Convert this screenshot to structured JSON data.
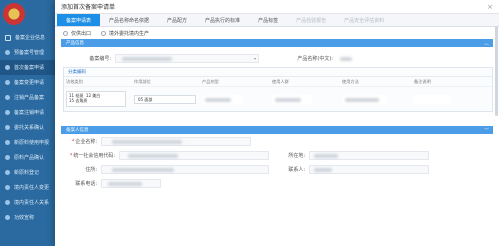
{
  "dialog": {
    "title": "添加首次备案申请单",
    "close": "×"
  },
  "tabs": [
    {
      "label": "备案申请表",
      "active": true,
      "muted": false
    },
    {
      "label": "产品名称命名依据",
      "active": false,
      "muted": false
    },
    {
      "label": "产品配方",
      "active": false,
      "muted": false
    },
    {
      "label": "产品执行的标准",
      "active": false,
      "muted": false
    },
    {
      "label": "产品标签",
      "active": false,
      "muted": false
    },
    {
      "label": "产品检验报告",
      "active": false,
      "muted": true
    },
    {
      "label": "产品安全评估资料",
      "active": false,
      "muted": true
    }
  ],
  "radios": [
    {
      "label": "仅供出口"
    },
    {
      "label": "境外委托境内生产"
    }
  ],
  "product_section": {
    "title": "产品信息",
    "chevron": "︿",
    "record_no_label": "备案编号:",
    "name_label": "产品名称(中文):",
    "subpanel_title": "分类编码",
    "columns": [
      "功效类别",
      "作用部位",
      "产品剂型",
      "使用人群",
      "使用方法",
      "备注说明"
    ],
    "efficacy_options": [
      "11 祛斑",
      "12 美白",
      "15 去角质"
    ],
    "site_value": "05 面部"
  },
  "applicant_section": {
    "title": "备案人信息",
    "chevron": "﹀",
    "company_label": "企业名称:",
    "credit_label": "统一社会信用代码:",
    "address_label": "住所:",
    "phone_label": "联系电话:",
    "province_label": "所在地:",
    "contact_label": "联系人:"
  },
  "app_sidebar": {
    "items": [
      "备案企业信息",
      "预备案号管理",
      "首次备案申请",
      "备案变更申请",
      "注销产品备案",
      "备案注销申请",
      "委托关系确认",
      "新原料使用申报",
      "原料产品确认",
      "新原料登记",
      "境内责任人变更",
      "境内责任人关系",
      "功效宣称"
    ],
    "active_index": 2
  }
}
